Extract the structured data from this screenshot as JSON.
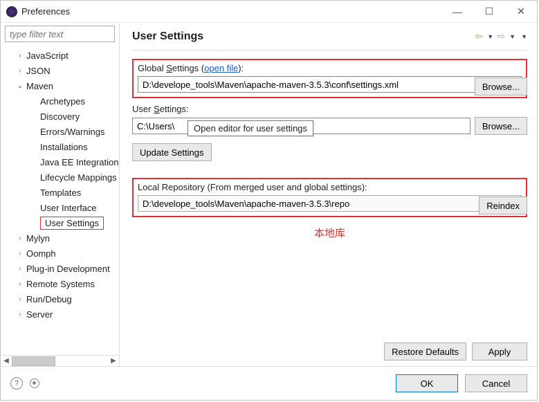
{
  "window": {
    "title": "Preferences"
  },
  "sidebar": {
    "filter_placeholder": "type filter text",
    "items": [
      {
        "label": "JavaScript",
        "expanded": false,
        "level": 1
      },
      {
        "label": "JSON",
        "expanded": false,
        "level": 1
      },
      {
        "label": "Maven",
        "expanded": true,
        "level": 1
      },
      {
        "label": "Archetypes",
        "level": 2
      },
      {
        "label": "Discovery",
        "level": 2
      },
      {
        "label": "Errors/Warnings",
        "level": 2
      },
      {
        "label": "Installations",
        "level": 2
      },
      {
        "label": "Java EE Integration",
        "level": 2
      },
      {
        "label": "Lifecycle Mappings",
        "level": 2
      },
      {
        "label": "Templates",
        "level": 2
      },
      {
        "label": "User Interface",
        "level": 2
      },
      {
        "label": "User Settings",
        "level": 2,
        "selected": true
      },
      {
        "label": "Mylyn",
        "expanded": false,
        "level": 1
      },
      {
        "label": "Oomph",
        "expanded": false,
        "level": 1
      },
      {
        "label": "Plug-in Development",
        "expanded": false,
        "level": 1
      },
      {
        "label": "Remote Systems",
        "expanded": false,
        "level": 1
      },
      {
        "label": "Run/Debug",
        "expanded": false,
        "level": 1
      },
      {
        "label": "Server",
        "expanded": false,
        "level": 1
      }
    ]
  },
  "page": {
    "title": "User Settings",
    "global_label_pre": "Global ",
    "global_label_u": "S",
    "global_label_post": "ettings (",
    "global_open_link": "open file",
    "global_label_end": "):",
    "global_value": "D:\\develope_tools\\Maven\\apache-maven-3.5.3\\conf\\settings.xml",
    "user_label_pre": "User ",
    "user_label_u": "S",
    "user_label_post": "ettings:",
    "user_value": "C:\\Users\\",
    "tooltip": "Open editor for user settings",
    "browse_label": "Browse...",
    "update_label": "Update Settings",
    "local_repo_label": "Local Repository (From merged user and global settings):",
    "local_repo_value": "D:\\develope_tools\\Maven\\apache-maven-3.5.3\\repo",
    "reindex_label": "Reindex",
    "annotation": "本地库",
    "restore_label": "Restore Defaults",
    "apply_label": "Apply"
  },
  "buttons": {
    "ok": "OK",
    "cancel": "Cancel"
  }
}
